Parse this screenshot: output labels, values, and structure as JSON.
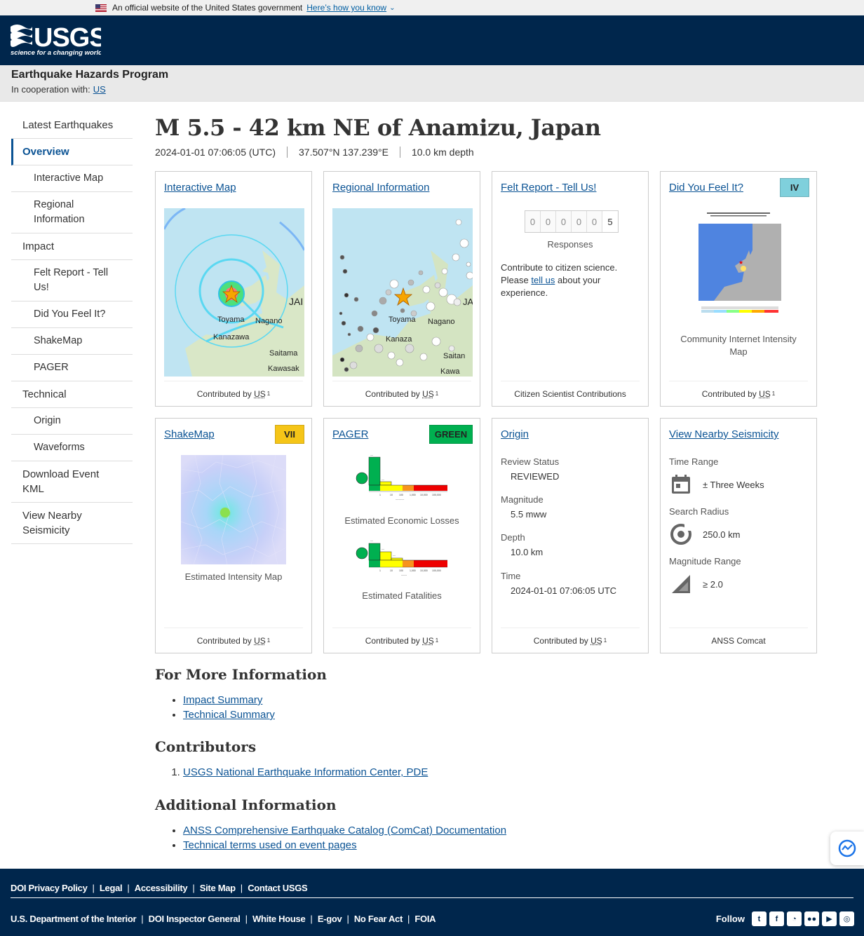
{
  "gov_banner": {
    "text": "An official website of the United States government",
    "link": "Here’s how you know"
  },
  "logo": {
    "name": "USGS",
    "tagline": "science for a changing world"
  },
  "program": {
    "title": "Earthquake Hazards Program",
    "coop_label": "In cooperation with:",
    "coop_link": "US"
  },
  "sidebar": {
    "items": [
      {
        "label": "Latest Earthquakes",
        "type": "top"
      },
      {
        "label": "Overview",
        "type": "active"
      },
      {
        "label": "Interactive Map",
        "type": "sub"
      },
      {
        "label": "Regional Information",
        "type": "sub"
      },
      {
        "label": "Impact",
        "type": "top"
      },
      {
        "label": "Felt Report - Tell Us!",
        "type": "sub"
      },
      {
        "label": "Did You Feel It?",
        "type": "sub"
      },
      {
        "label": "ShakeMap",
        "type": "sub"
      },
      {
        "label": "PAGER",
        "type": "sub"
      },
      {
        "label": "Technical",
        "type": "top"
      },
      {
        "label": "Origin",
        "type": "sub"
      },
      {
        "label": "Waveforms",
        "type": "sub"
      },
      {
        "label": "Download Event KML",
        "type": "top"
      },
      {
        "label": "View Nearby Seismicity",
        "type": "top"
      }
    ]
  },
  "event": {
    "title": "M 5.5 - 42 km NE of Anamizu, Japan",
    "time": "2024-01-01 07:06:05 (UTC)",
    "location": "37.507°N 137.239°E",
    "depth": "10.0 km depth"
  },
  "cards": {
    "interactive_map": {
      "title": "Interactive Map",
      "contrib": "Contributed by",
      "contrib_by": "US",
      "sup": "1",
      "labels": [
        "Toyama",
        "Nagano",
        "Kanazawa",
        "Saitama",
        "Kawasak",
        "JAI"
      ]
    },
    "regional": {
      "title": "Regional Information",
      "contrib": "Contributed by",
      "contrib_by": "US",
      "sup": "1",
      "labels": [
        "Toyama",
        "Nagano",
        "Kanaza",
        "Saitan",
        "Kawa",
        "JA"
      ]
    },
    "felt": {
      "title": "Felt Report - Tell Us!",
      "digits": [
        "0",
        "0",
        "0",
        "0",
        "0",
        "5"
      ],
      "responses_label": "Responses",
      "text_before": "Contribute to citizen science. Please ",
      "link": "tell us",
      "text_after": " about your experience.",
      "footer": "Citizen Scientist Contributions"
    },
    "dyfi": {
      "title": "Did You Feel It?",
      "badge": "IV",
      "badge_color": "#7fd0dc",
      "caption": "Community Internet Intensity Map",
      "contrib": "Contributed by",
      "contrib_by": "US",
      "sup": "1"
    },
    "shakemap": {
      "title": "ShakeMap",
      "badge": "VII",
      "badge_color": "#f5c518",
      "caption": "Estimated Intensity Map",
      "contrib": "Contributed by",
      "contrib_by": "US",
      "sup": "1"
    },
    "pager": {
      "title": "PAGER",
      "badge": "GREEN",
      "badge_color": "#00b050",
      "caption_losses": "Estimated Economic Losses",
      "caption_fatal": "Estimated Fatalities",
      "contrib": "Contributed by",
      "contrib_by": "US",
      "sup": "1"
    },
    "origin": {
      "title": "Origin",
      "review_label": "Review Status",
      "review": "REVIEWED",
      "mag_label": "Magnitude",
      "mag": "5.5 mww",
      "depth_label": "Depth",
      "depth": "10.0 km",
      "time_label": "Time",
      "time": "2024-01-01 07:06:05 UTC",
      "contrib": "Contributed by",
      "contrib_by": "US",
      "sup": "1"
    },
    "seismicity": {
      "title": "View Nearby Seismicity",
      "range_label": "Time Range",
      "range": "± Three Weeks",
      "radius_label": "Search Radius",
      "radius": "250.0 km",
      "mag_label": "Magnitude Range",
      "mag": "≥ 2.0",
      "footer": "ANSS Comcat"
    }
  },
  "more_info": {
    "heading": "For More Information",
    "links": [
      "Impact Summary",
      "Technical Summary"
    ]
  },
  "contributors": {
    "heading": "Contributors",
    "links": [
      "USGS National Earthquake Information Center, PDE"
    ]
  },
  "additional": {
    "heading": "Additional Information",
    "links": [
      "ANSS Comprehensive Earthquake Catalog (ComCat) Documentation",
      "Technical terms used on event pages"
    ]
  },
  "footer": {
    "row1": [
      "DOI Privacy Policy",
      "Legal",
      "Accessibility",
      "Site Map",
      "Contact USGS"
    ],
    "row2": [
      "U.S. Department of the Interior",
      "DOI Inspector General",
      "White House",
      "E-gov",
      "No Fear Act",
      "FOIA"
    ],
    "follow": "Follow",
    "social_icons": [
      "twitter-icon",
      "facebook-icon",
      "github-icon",
      "flickr-icon",
      "youtube-icon",
      "instagram-icon"
    ]
  }
}
